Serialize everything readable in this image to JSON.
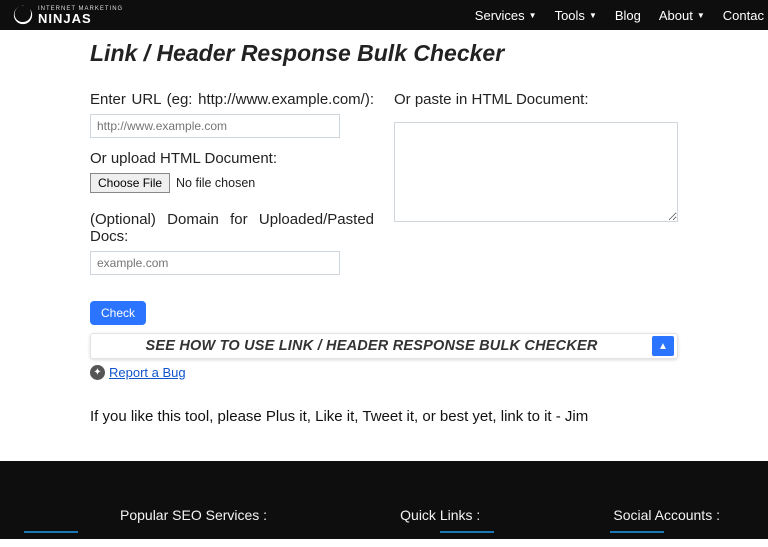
{
  "nav": {
    "brand_sub": "INTERNET MARKETING",
    "brand_main": "NINJAS",
    "items": [
      {
        "label": "Services",
        "caret": true
      },
      {
        "label": "Tools",
        "caret": true
      },
      {
        "label": "Blog",
        "caret": false
      },
      {
        "label": "About",
        "caret": true
      },
      {
        "label": "Contac",
        "caret": false
      }
    ]
  },
  "page": {
    "title": "Link / Header Response Bulk Checker",
    "url_label": "Enter URL (eg: http://www.example.com/):",
    "url_placeholder": "http://www.example.com",
    "upload_label": "Or upload HTML Document:",
    "file_button": "Choose File",
    "file_status": "No file chosen",
    "domain_label": "(Optional) Domain for Uploaded/Pasted Docs:",
    "domain_placeholder": "example.com",
    "paste_label": "Or paste in HTML Document:",
    "check_button": "Check",
    "accordion_title": "SEE HOW TO USE LINK / HEADER RESPONSE BULK CHECKER",
    "bug_link": "Report a Bug",
    "like_text": "If you like this tool, please Plus it, Like it, Tweet it, or best yet, link to it - Jim"
  },
  "footer": {
    "col1": "Popular SEO Services :",
    "col2": "Quick Links :",
    "col3": "Social Accounts :"
  }
}
